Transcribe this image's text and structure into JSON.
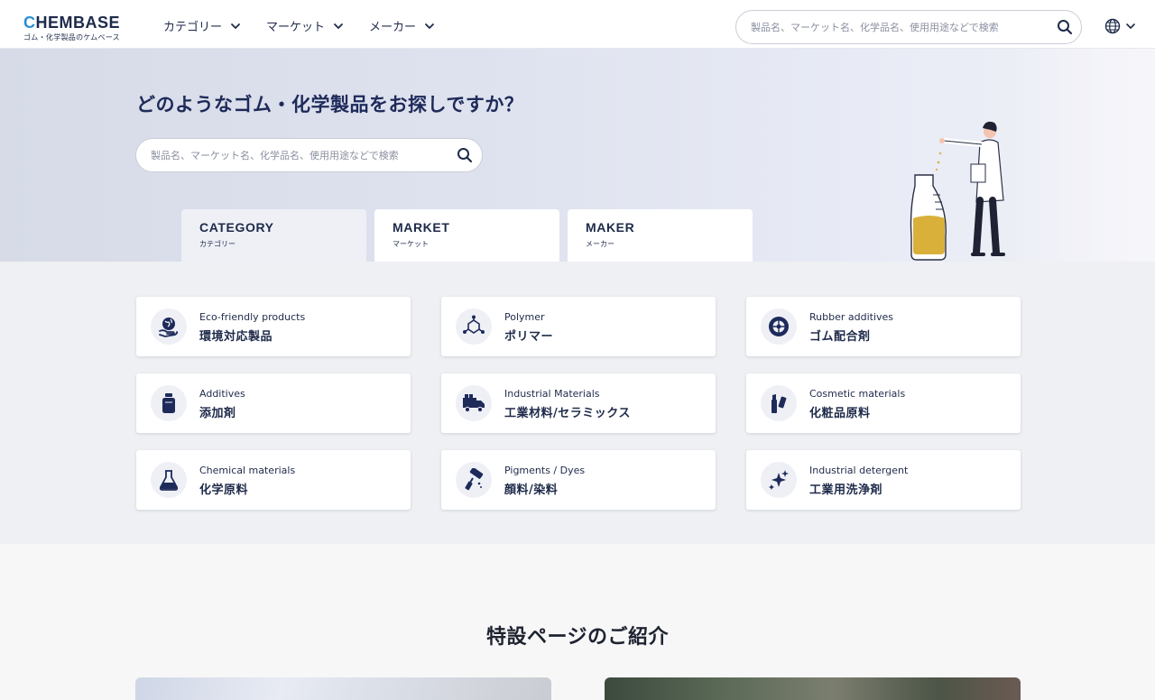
{
  "header": {
    "logo_main": "HEMBASE",
    "logo_c": "C",
    "logo_sub": "ゴム・化学製品のケムベース",
    "nav": [
      {
        "label": "カテゴリー"
      },
      {
        "label": "マーケット"
      },
      {
        "label": "メーカー"
      }
    ],
    "search_placeholder": "製品名、マーケット名、化学品名、使用用途などで検索"
  },
  "hero": {
    "title": "どのようなゴム・化学製品をお探しですか？",
    "search_placeholder": "製品名、マーケット名、化学品名、使用用途などで検索",
    "tabs": [
      {
        "en": "CATEGORY",
        "jp": "カテゴリー",
        "active": true
      },
      {
        "en": "MARKET",
        "jp": "マーケット",
        "active": false
      },
      {
        "en": "MAKER",
        "jp": "メーカー",
        "active": false
      }
    ]
  },
  "categories": [
    {
      "en": "Eco-friendly products",
      "jp": "環境対応製品",
      "icon": "eco-globe-icon"
    },
    {
      "en": "Polymer",
      "jp": "ポリマー",
      "icon": "polymer-molecule-icon"
    },
    {
      "en": "Rubber additives",
      "jp": "ゴム配合剤",
      "icon": "tire-icon"
    },
    {
      "en": "Additives",
      "jp": "添加剤",
      "icon": "bottle-icon"
    },
    {
      "en": "Industrial Materials",
      "jp": "工業材料/セラミックス",
      "icon": "truck-icon"
    },
    {
      "en": "Cosmetic materials",
      "jp": "化粧品原料",
      "icon": "cosmetics-icon"
    },
    {
      "en": "Chemical materials",
      "jp": "化学原料",
      "icon": "flask-icon"
    },
    {
      "en": "Pigments / Dyes",
      "jp": "顔料/染料",
      "icon": "paint-roller-icon"
    },
    {
      "en": "Industrial detergent",
      "jp": "工業用洗浄剤",
      "icon": "sparkle-icon"
    }
  ],
  "special": {
    "title": "特設ページのご紹介"
  },
  "colors": {
    "navy": "#1e2a4a",
    "logo_accent": "#2b8fd6",
    "card_bg": "#ffffff",
    "section_bg": "#eff0f3"
  }
}
